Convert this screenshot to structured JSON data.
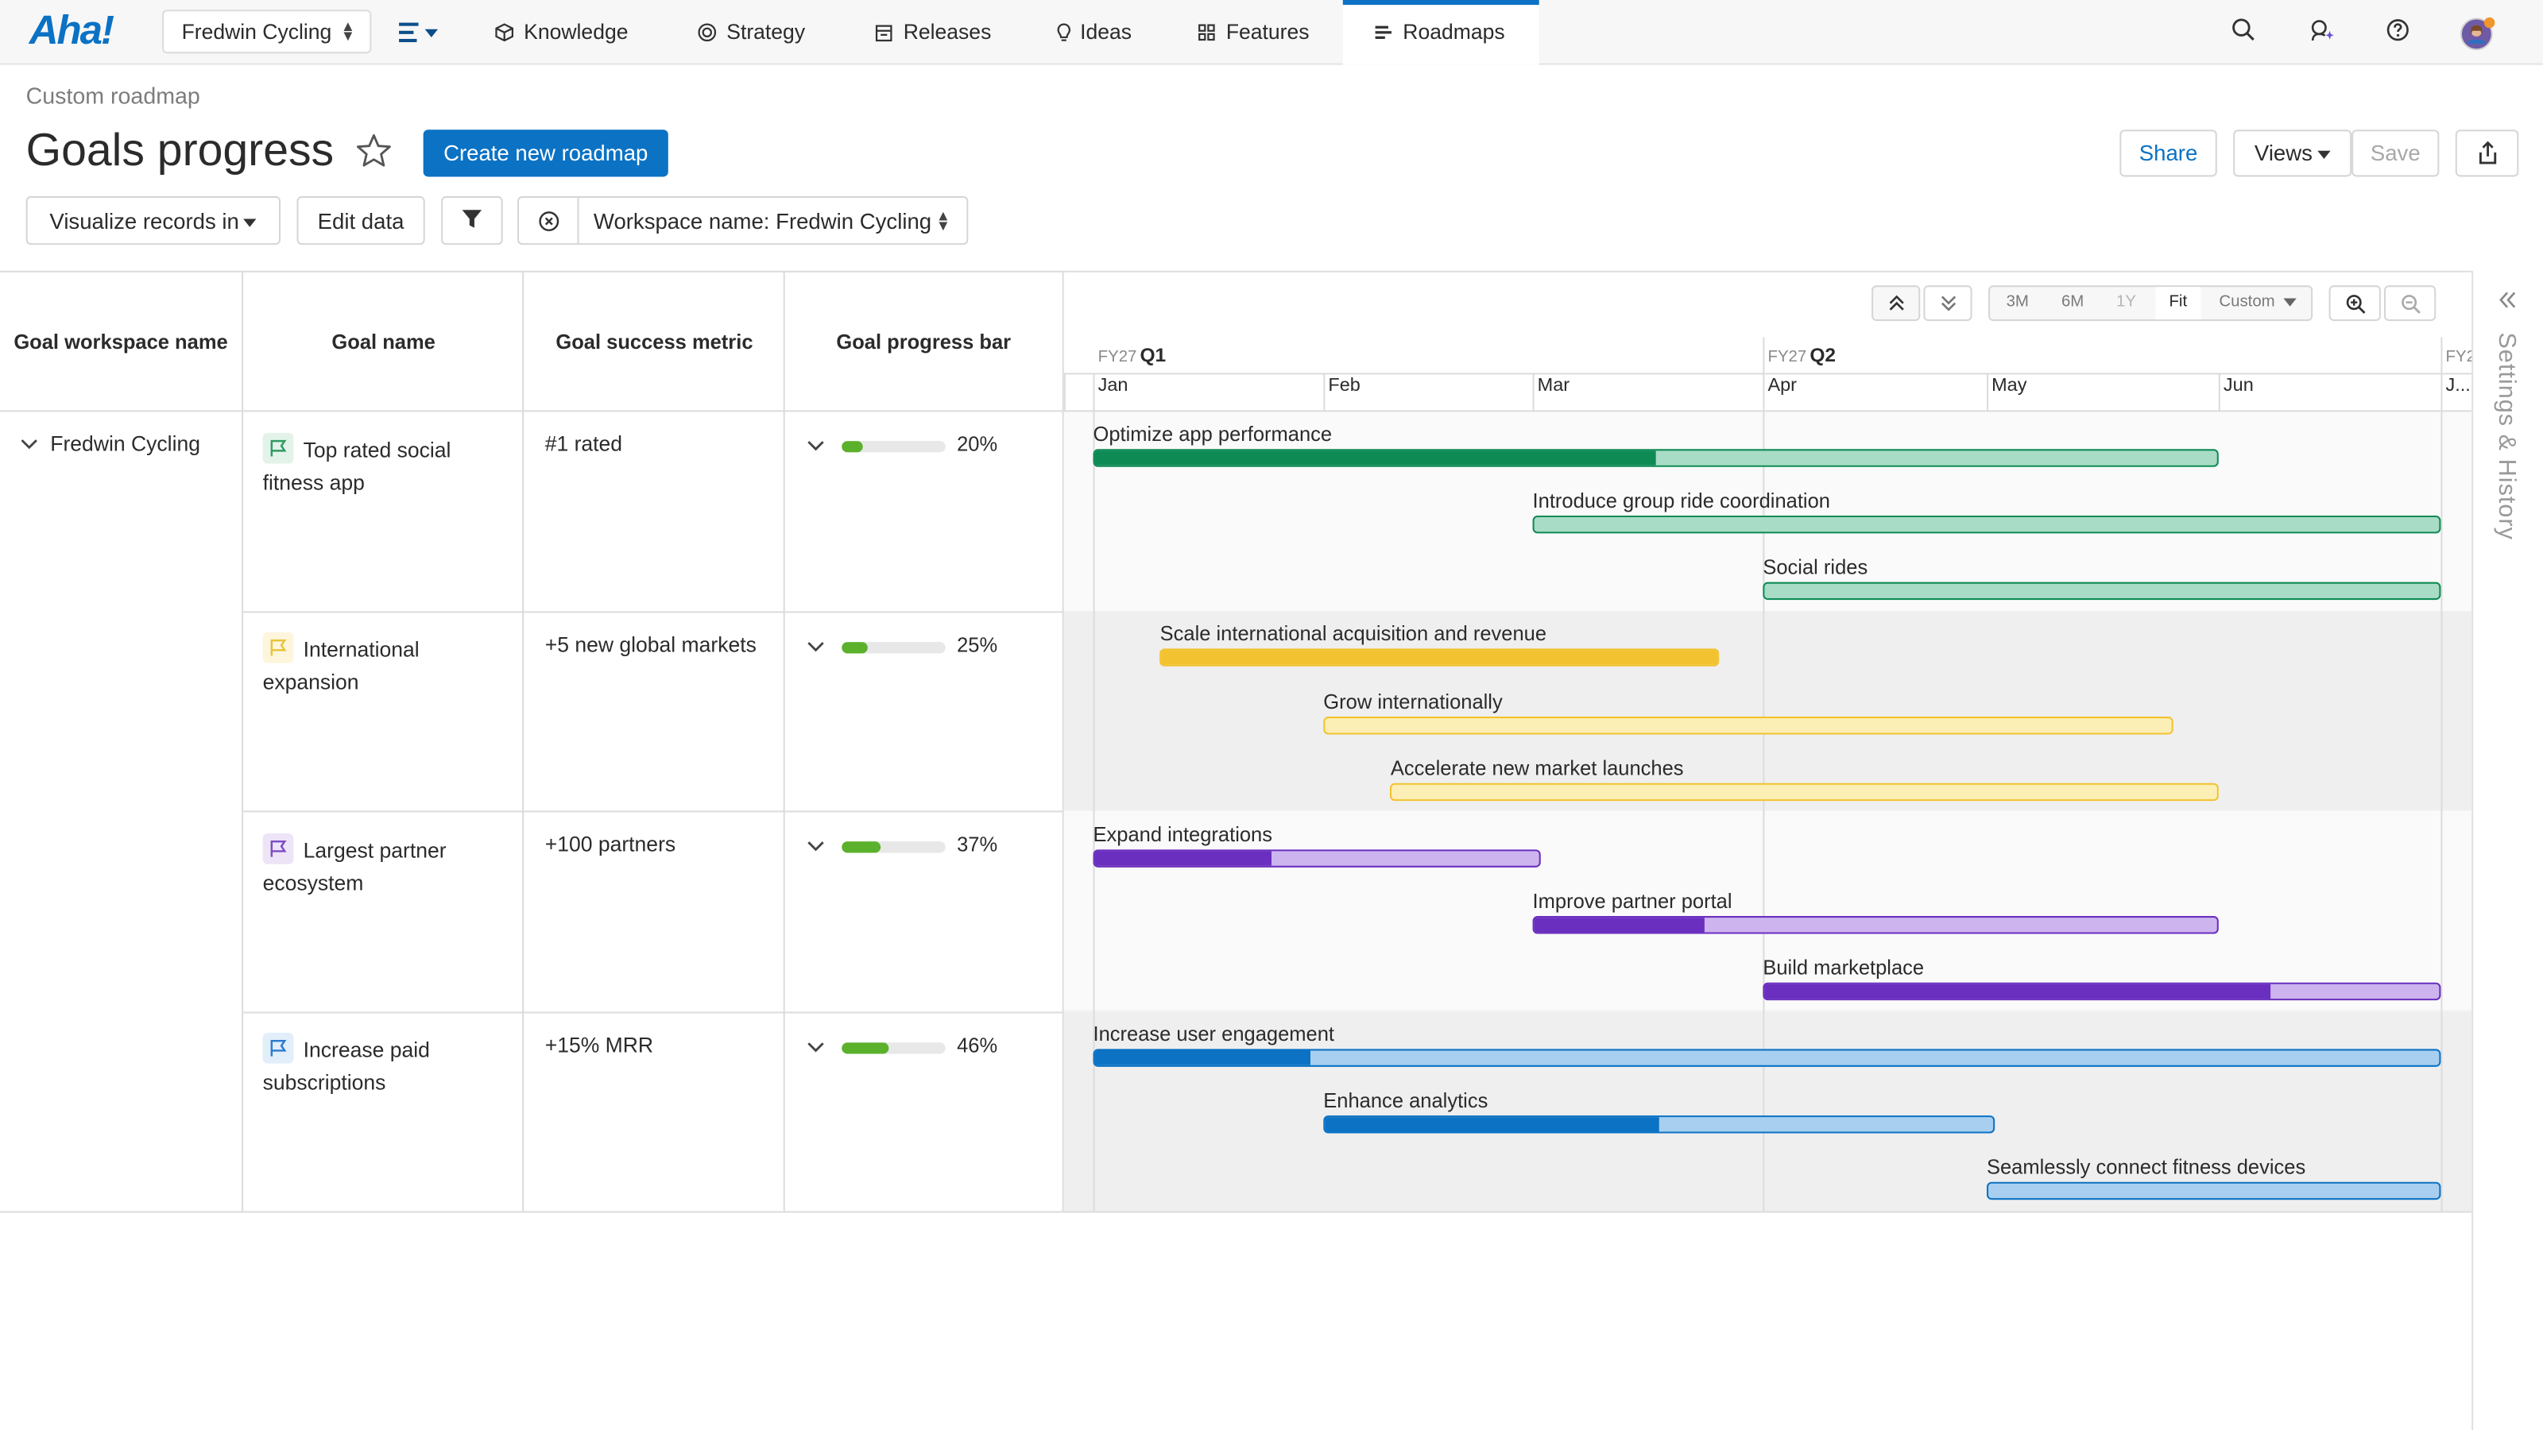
{
  "nav": {
    "logo": "Aha!",
    "workspace": "Fredwin Cycling",
    "items": [
      {
        "label": "Knowledge",
        "icon": "cube-icon"
      },
      {
        "label": "Strategy",
        "icon": "target-icon"
      },
      {
        "label": "Releases",
        "icon": "calendar-icon"
      },
      {
        "label": "Ideas",
        "icon": "lightbulb-icon"
      },
      {
        "label": "Features",
        "icon": "grid-icon"
      },
      {
        "label": "Roadmaps",
        "icon": "roadmap-icon"
      }
    ],
    "active": "Roadmaps"
  },
  "header": {
    "breadcrumb": "Custom roadmap",
    "title": "Goals progress",
    "create_label": "Create new roadmap",
    "share_label": "Share",
    "views_label": "Views",
    "save_label": "Save"
  },
  "toolbar": {
    "visualize_label": "Visualize records in",
    "edit_label": "Edit data",
    "filter_text": "Workspace name: Fredwin Cycling"
  },
  "table": {
    "headers": [
      "Goal workspace name",
      "Goal name",
      "Goal success metric",
      "Goal progress bar"
    ],
    "workspace": "Fredwin Cycling",
    "rows": [
      {
        "name": "Top rated social fitness app",
        "metric": "#1 rated",
        "progress": 20,
        "progress_label": "20%",
        "flag_color": "#2f9a63",
        "flag_bg": "#e3f3ea"
      },
      {
        "name": "International expansion",
        "metric": "+5 new global markets",
        "progress": 25,
        "progress_label": "25%",
        "flag_color": "#e7c43a",
        "flag_bg": "#fdf6dc"
      },
      {
        "name": "Largest partner ecosystem",
        "metric": "+100 partners",
        "progress": 37,
        "progress_label": "37%",
        "flag_color": "#7d4cc4",
        "flag_bg": "#ede4f8"
      },
      {
        "name": "Increase paid subscriptions",
        "metric": "+15% MRR",
        "progress": 46,
        "progress_label": "46%",
        "flag_color": "#2a7cd0",
        "flag_bg": "#e2eefa"
      }
    ]
  },
  "timeline": {
    "zoom": [
      "3M",
      "6M",
      "1Y",
      "Fit",
      "Custom"
    ],
    "zoom_active": "Fit",
    "quarters": [
      {
        "fy": "FY27",
        "q": "Q1"
      },
      {
        "fy": "FY27",
        "q": "Q2"
      },
      {
        "fy": "FY2",
        "q": ""
      }
    ],
    "months": [
      "Jan",
      "Feb",
      "Mar",
      "Apr",
      "May",
      "Jun",
      "J..."
    ],
    "bars": [
      {
        "label": "Optimize app performance",
        "row": 0,
        "lane": 0,
        "start": "Jan 1",
        "end": "Jun 1",
        "progress": 0.5,
        "color": "#0e8a55",
        "light": "#a8dcc6"
      },
      {
        "label": "Introduce group ride coordination",
        "row": 0,
        "lane": 1,
        "start": "Mar 1",
        "end": "Jun 30",
        "progress": 0,
        "color": "#0e8a55",
        "light": "#a8dcc6"
      },
      {
        "label": "Social rides",
        "row": 0,
        "lane": 2,
        "start": "Apr 1",
        "end": "Jun 30",
        "progress": 0,
        "color": "#0e8a55",
        "light": "#a8dcc6"
      },
      {
        "label": "Scale international acquisition and revenue",
        "row": 1,
        "lane": 0,
        "start": "Jan 10",
        "end": "Mar 25",
        "progress": 1,
        "color": "#f2c230",
        "light": "#f9e69a"
      },
      {
        "label": "Grow internationally",
        "row": 1,
        "lane": 1,
        "start": "Feb 1",
        "end": "May 25",
        "progress": 0,
        "color": "#f2c230",
        "light": "#fcefb5"
      },
      {
        "label": "Accelerate new market launches",
        "row": 1,
        "lane": 2,
        "start": "Feb 10",
        "end": "Jun 1",
        "progress": 0,
        "color": "#f2c230",
        "light": "#fcefb5"
      },
      {
        "label": "Expand integrations",
        "row": 2,
        "lane": 0,
        "start": "Jan 1",
        "end": "Mar 1",
        "progress": 0.4,
        "color": "#6a2fbf",
        "light": "#cdb4ee"
      },
      {
        "label": "Improve partner portal",
        "row": 2,
        "lane": 1,
        "start": "Mar 1",
        "end": "Jun 1",
        "progress": 0.25,
        "color": "#6a2fbf",
        "light": "#cdb4ee"
      },
      {
        "label": "Build marketplace",
        "row": 2,
        "lane": 2,
        "start": "Apr 1",
        "end": "Jun 30",
        "progress": 0.75,
        "color": "#6a2fbf",
        "light": "#cdb4ee"
      },
      {
        "label": "Increase user engagement",
        "row": 3,
        "lane": 0,
        "start": "Jan 1",
        "end": "Jun 30",
        "progress": 0.16,
        "color": "#0b72c4",
        "light": "#a8cff0"
      },
      {
        "label": "Enhance analytics",
        "row": 3,
        "lane": 1,
        "start": "Feb 1",
        "end": "May 1",
        "progress": 0.5,
        "color": "#0b72c4",
        "light": "#a8cff0"
      },
      {
        "label": "Seamlessly connect fitness devices",
        "row": 3,
        "lane": 2,
        "start": "May 1",
        "end": "Jun 30",
        "progress": 0,
        "color": "#0b72c4",
        "light": "#a8cff0"
      }
    ]
  },
  "side_panel": {
    "label": "Settings & History"
  }
}
